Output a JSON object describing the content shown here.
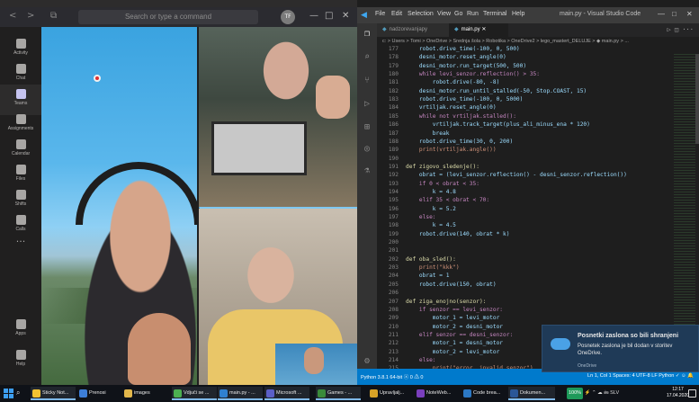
{
  "teams": {
    "nav_back": "<",
    "nav_forward": ">",
    "compose_icon": "⧉",
    "search_placeholder": "Search or type a command",
    "avatar_initials": "TF",
    "window_controls": [
      "—",
      "□",
      "✕"
    ],
    "rail": [
      {
        "label": "Activity",
        "icon": "bell-icon"
      },
      {
        "label": "Chat",
        "icon": "chat-icon"
      },
      {
        "label": "Teams",
        "icon": "teams-icon",
        "active": true
      },
      {
        "label": "Assignments",
        "icon": "assignments-icon"
      },
      {
        "label": "Calendar",
        "icon": "calendar-icon"
      },
      {
        "label": "Files",
        "icon": "files-icon"
      },
      {
        "label": "Shifts",
        "icon": "shifts-icon"
      },
      {
        "label": "Calls",
        "icon": "phone-icon"
      },
      {
        "label": "Apps",
        "icon": "apps-icon"
      },
      {
        "label": "Help",
        "icon": "help-icon"
      }
    ],
    "rail_more": "···"
  },
  "vscode": {
    "menu": [
      "File",
      "Edit",
      "Selection",
      "View",
      "Go",
      "Run",
      "Terminal",
      "Help"
    ],
    "title": "main.py - Visual Studio Code",
    "window_controls": [
      "—",
      "□",
      "✕"
    ],
    "tabs": [
      {
        "label": "nadzorevanjapy",
        "active": false
      },
      {
        "label": "main.py",
        "active": true,
        "close": "✕"
      }
    ],
    "tab_actions": "▷ ◫ ···",
    "breadcrumb": "c: > Users > Tomi > OneDrive > Srednja šola > Robotika > OneDrive2 > lego_mastert_DELUJE > ◆ main.py > ...",
    "code_lines": [
      {
        "n": "177",
        "code": "    robot.drive_time(-100, 0, 500)"
      },
      {
        "n": "178",
        "code": "    desni_motor.reset_angle(0)"
      },
      {
        "n": "179",
        "code": "    desni_motor.run_target(500, 500)"
      },
      {
        "n": "180",
        "code": "    while levi_senzor.reflection() > 35:"
      },
      {
        "n": "181",
        "code": "        robot.drive(-80, -8)"
      },
      {
        "n": "182",
        "code": "    desni_motor.run_until_stalled(-50, Stop.COAST, 15)"
      },
      {
        "n": "183",
        "code": "    robot.drive_time(-100, 0, 5000)"
      },
      {
        "n": "184",
        "code": "    vrtiljak.reset_angle(0)"
      },
      {
        "n": "185",
        "code": "    while not vrtiljak.stalled():"
      },
      {
        "n": "186",
        "code": "        vrtiljak.track_target(plus_ali_minus_ena * 120)"
      },
      {
        "n": "187",
        "code": "        break"
      },
      {
        "n": "188",
        "code": "    robot.drive_time(30, 0, 200)"
      },
      {
        "n": "189",
        "code": "    print(vrtiljak.angle())"
      },
      {
        "n": "190",
        "code": ""
      },
      {
        "n": "191",
        "code": "def zigovo_sledenje():"
      },
      {
        "n": "192",
        "code": "    obrat = (levi_senzor.reflection() - desni_senzor.reflection())"
      },
      {
        "n": "193",
        "code": "    if 0 < obrat < 35:"
      },
      {
        "n": "194",
        "code": "        k = 4.8"
      },
      {
        "n": "195",
        "code": "    elif 35 < obrat < 70:"
      },
      {
        "n": "196",
        "code": "        k = 5.2"
      },
      {
        "n": "197",
        "code": "    else:"
      },
      {
        "n": "198",
        "code": "        k = 4.5"
      },
      {
        "n": "199",
        "code": "    robot.drive(140, obrat * k)"
      },
      {
        "n": "200",
        "code": ""
      },
      {
        "n": "201",
        "code": ""
      },
      {
        "n": "202",
        "code": "def oba_sled():"
      },
      {
        "n": "203",
        "code": "    print(\"kkk\")"
      },
      {
        "n": "204",
        "code": "    obrat = 1"
      },
      {
        "n": "205",
        "code": "    robot.drive(150, obrat)"
      },
      {
        "n": "206",
        "code": ""
      },
      {
        "n": "207",
        "code": "def ziga_enojno(senzor):"
      },
      {
        "n": "208",
        "code": "    if senzor == levi_senzor:"
      },
      {
        "n": "209",
        "code": "        motor_1 = levi_motor"
      },
      {
        "n": "210",
        "code": "        motor_2 = desni_motor"
      },
      {
        "n": "211",
        "code": "    elif senzor == desni_senzor:"
      },
      {
        "n": "212",
        "code": "        motor_1 = desni_motor"
      },
      {
        "n": "213",
        "code": "        motor_2 = levi_motor"
      },
      {
        "n": "214",
        "code": "    else:"
      },
      {
        "n": "215",
        "code": "        print(\"error, invalid senzor\")"
      },
      {
        "n": "216",
        "code": ""
      }
    ],
    "status_left": "Python 3.8.1 64-bit   ⓧ 0 ⚠ 0",
    "status_right": "Ln 1, Col 1   Spaces: 4   UTF-8   LF   Python   ✓   ☺  🔔"
  },
  "toast": {
    "title": "Posnetki zaslona so bili shranjeni",
    "body": "Posnetek zaslona je bil dodan v storitev OneDrive.",
    "source": "OneDrive"
  },
  "taskbar": {
    "search_icon": "⌕",
    "apps": [
      {
        "label": "Sticky Not...",
        "color": "#f1c232",
        "running": true
      },
      {
        "label": "Prenosi",
        "color": "#3d7ed8",
        "running": false
      },
      {
        "label": "images",
        "color": "#e2b74b",
        "running": false
      },
      {
        "label": "Vdjuči se ...",
        "color": "#4caf50",
        "running": true
      },
      {
        "label": "main.py - ...",
        "color": "#2f80d0",
        "running": true
      },
      {
        "label": "Microsoft ...",
        "color": "#5b5fc7",
        "running": true
      },
      {
        "label": "Games - ...",
        "color": "#3a8a3a",
        "running": true
      },
      {
        "label": "Upravljalj...",
        "color": "#d7a227",
        "running": false
      },
      {
        "label": "NoteWeb...",
        "color": "#7a3fbd",
        "running": false
      },
      {
        "label": "Code brea...",
        "color": "#2c78c4",
        "running": false
      },
      {
        "label": "Dokumen...",
        "color": "#2b5797",
        "running": true
      }
    ],
    "battery": "100%",
    "tray": "⚡ ⌃ ☁ 🖮 SLV",
    "time": "12:17",
    "date": "17.04.2020"
  }
}
